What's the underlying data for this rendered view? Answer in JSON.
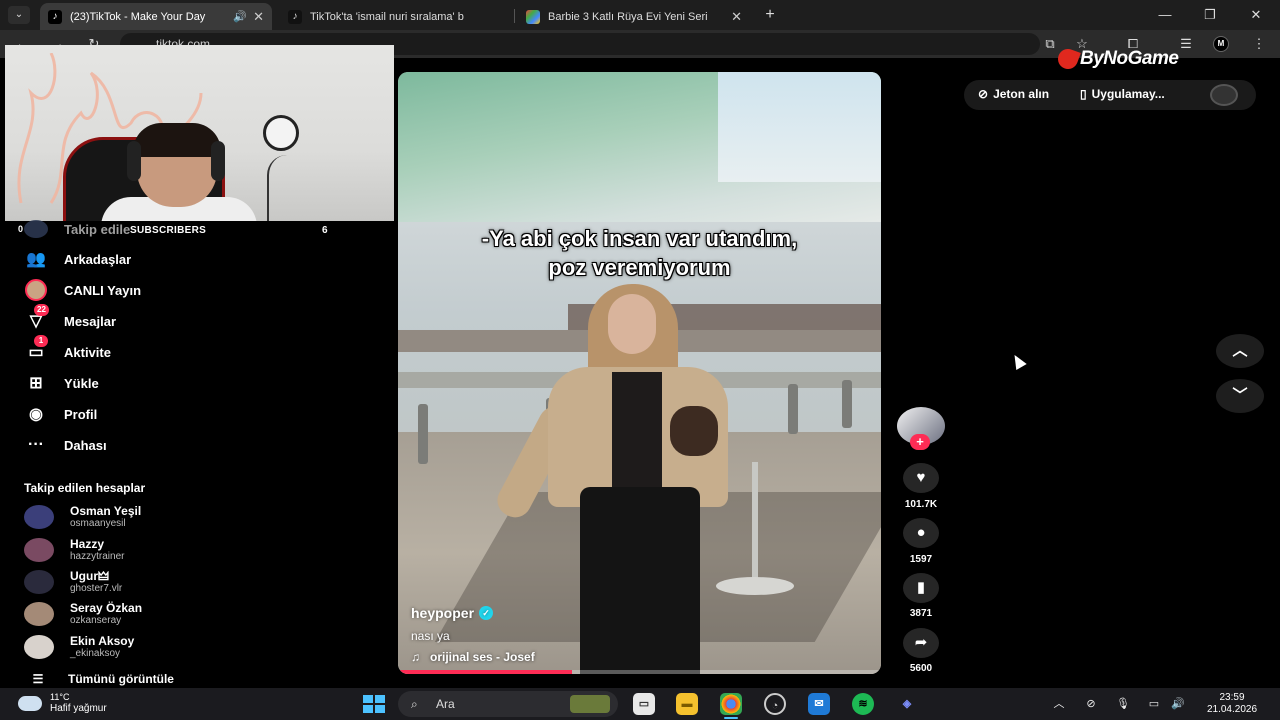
{
  "browser": {
    "tabs": [
      {
        "title": "(23)TikTok - Make Your Day",
        "active": true
      },
      {
        "title": "TikTok'ta 'ismail nuri sıralama' b",
        "active": false
      },
      {
        "title": "Barbie 3 Katlı Rüya Evi Yeni Seri",
        "active": false
      }
    ],
    "url": "tiktok.com",
    "profile_initial": "M"
  },
  "overlay": {
    "brand": "ByNoGame",
    "subscribers_label": "SUBSCRIBERS",
    "subscribers_count": "6",
    "left_number": "0"
  },
  "sidebar": {
    "following_label": "Takip edile",
    "nav": [
      {
        "label": "Arkadaşlar",
        "icon": "friends-icon"
      },
      {
        "label": "CANLI Yayın",
        "icon": "live-icon"
      },
      {
        "label": "Mesajlar",
        "icon": "messages-icon",
        "badge": "22"
      },
      {
        "label": "Aktivite",
        "icon": "activity-icon",
        "badge": "1"
      },
      {
        "label": "Yükle",
        "icon": "upload-icon"
      },
      {
        "label": "Profil",
        "icon": "profile-icon"
      },
      {
        "label": "Dahası",
        "icon": "more-icon"
      }
    ],
    "following_title": "Takip edilen hesaplar",
    "accounts": [
      {
        "name": "Osman Yeşil",
        "handle": "osmaanyesil",
        "color": "#3b3f7a"
      },
      {
        "name": "Hazzy",
        "handle": "hazzytrainer",
        "color": "#7a4a62"
      },
      {
        "name": "Ugur🜲",
        "handle": "ghoster7.vlr",
        "color": "#2a2a3c"
      },
      {
        "name": "Seray Özkan",
        "handle": "ozkanseray",
        "color": "#a48a77"
      },
      {
        "name": "Ekin Aksoy",
        "handle": "_ekinaksoy",
        "color": "#d8d2cc"
      }
    ],
    "see_all": "Tümünü görüntüle"
  },
  "video": {
    "caption_line1": "-Ya abi çok insan var utandım,",
    "caption_line2": "poz veremiyorum",
    "author": "heypoper",
    "description": "nası ya",
    "music": "orijinal ses - Josef",
    "progress": 0.36
  },
  "actions": {
    "likes": "101.7K",
    "comments": "1597",
    "saves": "3871",
    "shares": "5600"
  },
  "topbar": {
    "coins_label": "Jeton alın",
    "app_label": "Uygulamay..."
  },
  "taskbar": {
    "temperature": "11°C",
    "weather": "Hafif yağmur",
    "search_placeholder": "Ara",
    "time": "23:59",
    "date": "21.04.2026"
  },
  "colors": {
    "accent": "#fe2c55",
    "verified": "#20d5ec",
    "windows_blue": "#4cc2ff"
  }
}
